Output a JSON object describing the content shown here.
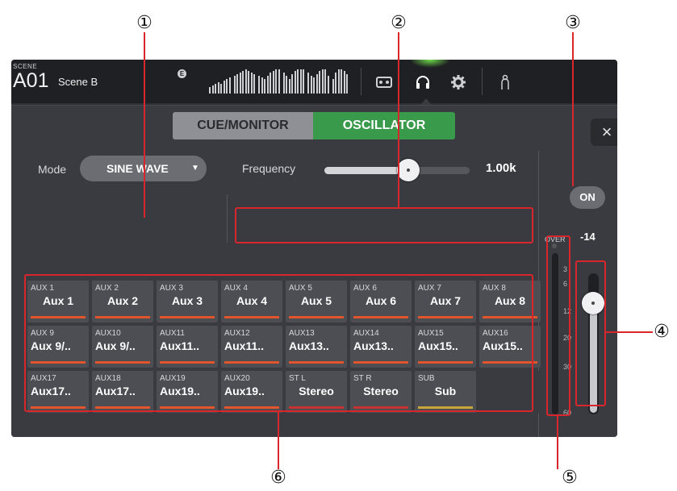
{
  "callouts": [
    "①",
    "②",
    "③",
    "④",
    "⑤",
    "⑥"
  ],
  "header": {
    "scene_label": "SCENE",
    "scene_number": "A01",
    "scene_name": "Scene B",
    "edit_badge": "E",
    "icons": [
      "meter-bridge-icon",
      "recorder-icon",
      "headphones-icon",
      "gear-icon",
      "user-icon"
    ]
  },
  "tabs": [
    {
      "label": "CUE/MONITOR",
      "active": false
    },
    {
      "label": "OSCILLATOR",
      "active": true
    }
  ],
  "close_label": "×",
  "mode": {
    "label": "Mode",
    "value": "SINE WAVE",
    "arrow": "▼"
  },
  "frequency": {
    "label": "Frequency",
    "value": "1.00k",
    "slider_position": 0.58
  },
  "output": {
    "on_label": "ON",
    "over_label": "OVER",
    "level": "-14",
    "fader_position": 0.87,
    "meter_scale": [
      "3",
      "6",
      "12",
      "20",
      "30",
      "60"
    ]
  },
  "assign_grid": [
    {
      "small": "AUX 1",
      "big": "Aux 1",
      "bar": "#e2542b"
    },
    {
      "small": "AUX 2",
      "big": "Aux 2",
      "bar": "#e2542b"
    },
    {
      "small": "AUX 3",
      "big": "Aux 3",
      "bar": "#e2542b"
    },
    {
      "small": "AUX 4",
      "big": "Aux 4",
      "bar": "#e2542b"
    },
    {
      "small": "AUX 5",
      "big": "Aux 5",
      "bar": "#e2542b"
    },
    {
      "small": "AUX 6",
      "big": "Aux 6",
      "bar": "#e2542b"
    },
    {
      "small": "AUX 7",
      "big": "Aux 7",
      "bar": "#e2542b"
    },
    {
      "small": "AUX 8",
      "big": "Aux 8",
      "bar": "#e2542b"
    },
    {
      "small": "AUX 9",
      "big": "Aux 9/..",
      "bar": "#e2542b"
    },
    {
      "small": "AUX10",
      "big": "Aux 9/..",
      "bar": "#e2542b"
    },
    {
      "small": "AUX11",
      "big": "Aux11..",
      "bar": "#e2542b"
    },
    {
      "small": "AUX12",
      "big": "Aux11..",
      "bar": "#e2542b"
    },
    {
      "small": "AUX13",
      "big": "Aux13..",
      "bar": "#e2542b"
    },
    {
      "small": "AUX14",
      "big": "Aux13..",
      "bar": "#e2542b"
    },
    {
      "small": "AUX15",
      "big": "Aux15..",
      "bar": "#e2542b"
    },
    {
      "small": "AUX16",
      "big": "Aux15..",
      "bar": "#e2542b"
    },
    {
      "small": "AUX17",
      "big": "Aux17..",
      "bar": "#e2542b"
    },
    {
      "small": "AUX18",
      "big": "Aux17..",
      "bar": "#e2542b"
    },
    {
      "small": "AUX19",
      "big": "Aux19..",
      "bar": "#e2542b"
    },
    {
      "small": "AUX20",
      "big": "Aux19..",
      "bar": "#e2542b"
    },
    {
      "small": "ST L",
      "big": "Stereo",
      "bar": "#c7312f"
    },
    {
      "small": "ST R",
      "big": "Stereo",
      "bar": "#c7312f"
    },
    {
      "small": "SUB",
      "big": "Sub",
      "bar": "#c9a53a"
    }
  ],
  "colors": {
    "accent_green": "#3a9a4c",
    "callout_red": "#d9262c",
    "aux_bar": "#e2542b"
  }
}
